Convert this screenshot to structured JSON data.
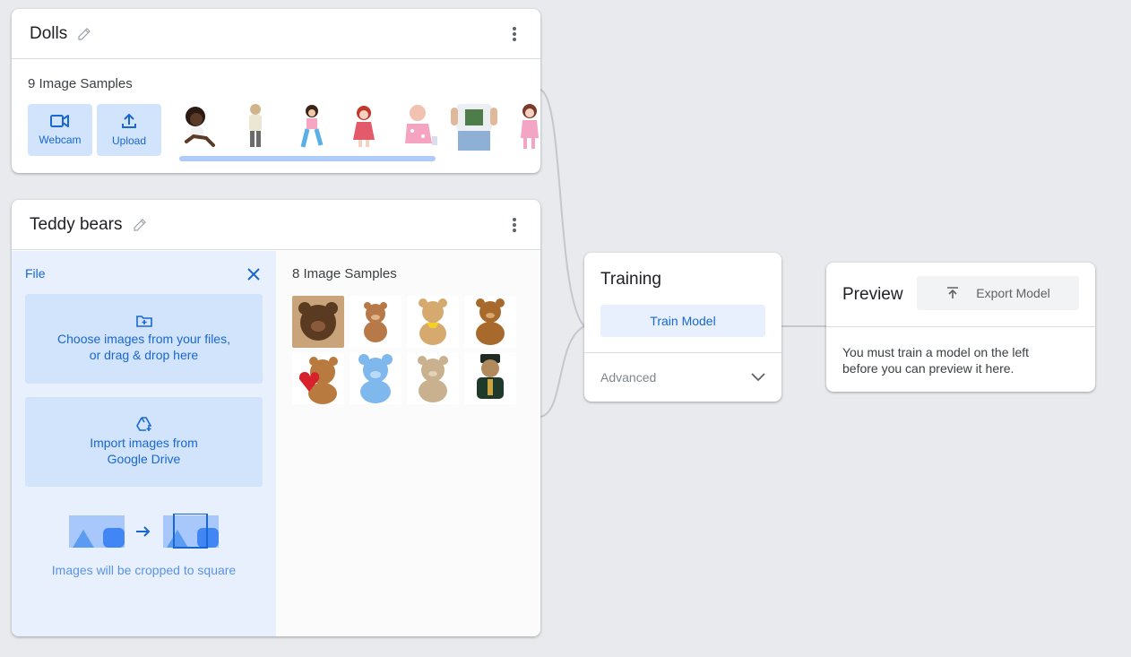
{
  "dolls": {
    "title": "Dolls",
    "samples_label": "9 Image Samples",
    "webcam_label": "Webcam",
    "upload_label": "Upload"
  },
  "teddy": {
    "title": "Teddy bears",
    "samples_label": "8 Image Samples",
    "file_label": "File",
    "choose_files_line1": "Choose images from your files,",
    "choose_files_line2": "or drag & drop here",
    "drive_line1": "Import images from",
    "drive_line2": "Google Drive",
    "crop_caption": "Images will be cropped to square"
  },
  "training": {
    "title": "Training",
    "train_button": "Train Model",
    "advanced_label": "Advanced"
  },
  "preview": {
    "title": "Preview",
    "export_button": "Export Model",
    "message_line1": "You must train a model on the left",
    "message_line2": "before you can preview it here."
  },
  "colors": {
    "accent": "#1967d2",
    "accent_light": "#d2e3fc",
    "panel_bg": "#e8f0fe",
    "canvas_bg": "#e8eaed"
  }
}
